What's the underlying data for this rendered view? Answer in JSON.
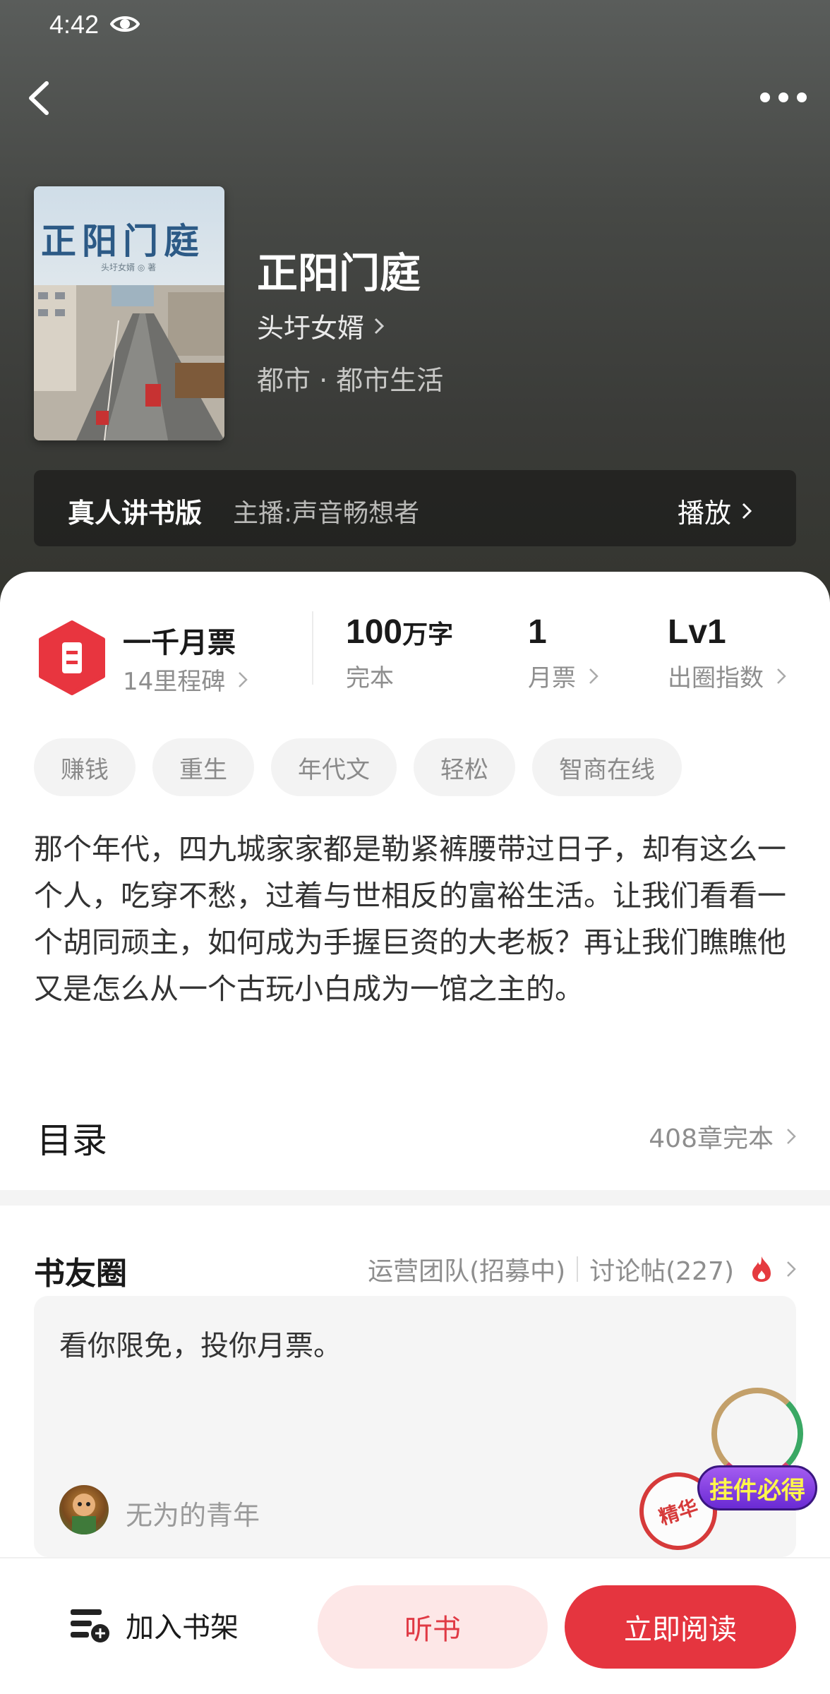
{
  "status_bar": {
    "time": "4:42"
  },
  "book": {
    "cover_title": "正阳门庭",
    "cover_author": "头圩女婿 ◎ 著",
    "title": "正阳门庭",
    "author": "头圩女婿",
    "genre": "都市 · 都市生活"
  },
  "audio": {
    "title": "真人讲书版",
    "host": "主播:声音畅想者",
    "play_label": "播放"
  },
  "stats": {
    "milestone_title": "一千月票",
    "milestone_sub": "14里程碑",
    "words_value": "100",
    "words_unit": "万字",
    "words_label": "完本",
    "ticket_value": "1",
    "ticket_label": "月票",
    "level_value": "Lv1",
    "level_label": "出圈指数"
  },
  "tags": [
    "赚钱",
    "重生",
    "年代文",
    "轻松",
    "智商在线"
  ],
  "synopsis": "那个年代，四九城家家都是勒紧裤腰带过日子，却有这么一个人，吃穿不愁，过着与世相反的富裕生活。让我们看看一个胡同顽主，如何成为手握巨资的大老板？再让我们瞧瞧他又是怎么从一个古玩小白成为一馆之主的。",
  "toc": {
    "label": "目录",
    "info": "408章完本"
  },
  "circle": {
    "title": "书友圈",
    "ops_link": "运营团队(招募中)",
    "discuss_link": "讨论帖(227)",
    "post_text": "看你限免，投你月票。",
    "post_user": "无为的青年",
    "essence_badge": "精华",
    "pendant_label": "挂件必得"
  },
  "bottom": {
    "shelf_label": "加入书架",
    "listen_label": "听书",
    "read_label": "立即阅读"
  },
  "colors": {
    "accent": "#e5353f",
    "accent_light": "#fde7e7"
  }
}
